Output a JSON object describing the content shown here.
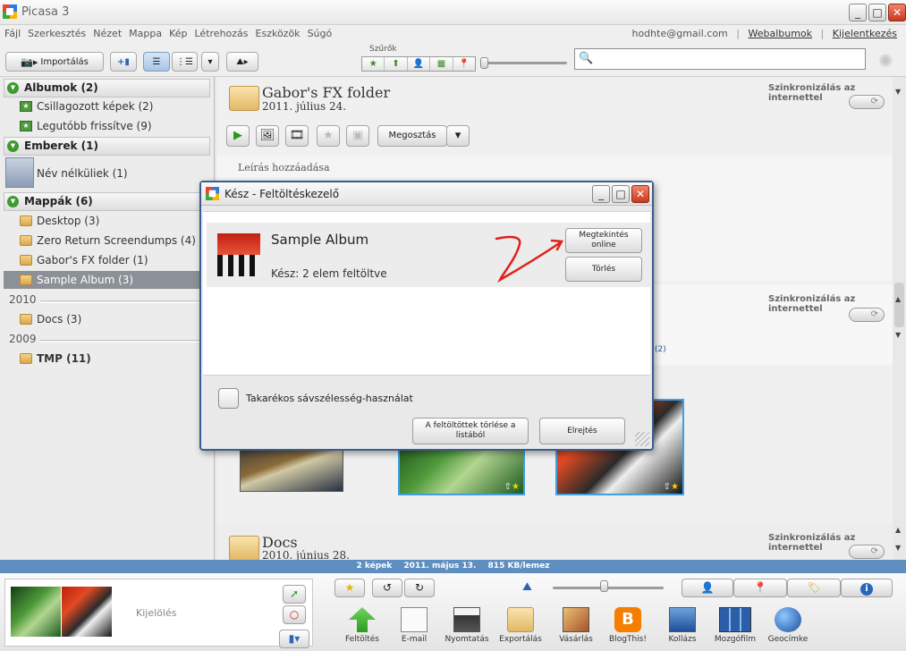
{
  "window": {
    "title": "Picasa 3",
    "min": "_",
    "max": "□",
    "close": "✕"
  },
  "menu": {
    "items": [
      "Fájl",
      "Szerkesztés",
      "Nézet",
      "Mappa",
      "Kép",
      "Létrehozás",
      "Eszközök",
      "Súgó"
    ],
    "account": "hodhte@gmail.com",
    "web_albums": "Webalbumok",
    "logout": "Kijelentkezés"
  },
  "toolbar": {
    "import": "Importálás",
    "filters_label": "Szűrők",
    "filter_icons": [
      "★",
      "⬆",
      "👤",
      "▦",
      "📍"
    ]
  },
  "sidebar": {
    "albums_header": "Albumok (2)",
    "albums": [
      "Csillagozott képek (2)",
      "Legutóbb frissítve (9)"
    ],
    "people_header": "Emberek (1)",
    "people": [
      "Név nélküliek (1)"
    ],
    "folders_header": "Mappák (6)",
    "folders": [
      "Desktop (3)",
      "Zero Return Screendumps (4)",
      "Gabor's FX folder (1)",
      "Sample Album (3)"
    ],
    "year1": "2010",
    "folders_2010": [
      "Docs (3)"
    ],
    "year2": "2009",
    "folders_2009": [
      "TMP (11)"
    ]
  },
  "main": {
    "album1_title": "Gabor's FX folder",
    "album1_date": "2011. július 24.",
    "sync_label": "Szinkronizálás az internettel",
    "share": "Megosztás",
    "description_placeholder": "Leírás hozzáadása",
    "album_count_link": "(2)",
    "album2_title": "Docs",
    "album2_date": "2010. június 28."
  },
  "status": {
    "count": "2 képek",
    "date": "2011. május 13.",
    "size": "815 KB/lemez"
  },
  "tray": {
    "selection_label": "Kijelölés",
    "actions": [
      "Feltöltés",
      "E-mail",
      "Nyomtatás",
      "Exportálás",
      "Vásárlás",
      "BlogThis!",
      "Kollázs",
      "Mozgófilm",
      "Geocímke"
    ]
  },
  "dialog": {
    "title": "Kész - Feltöltéskezelő",
    "album_name": "Sample Album",
    "status": "Kész: 2 elem feltöltve",
    "view_online": "Megtekintés online",
    "delete": "Törlés",
    "economy_label": "Takarékos sávszélesség-használat",
    "clear_uploaded": "A feltöltöttek törlése a listából",
    "hide": "Elrejtés"
  },
  "colors": {
    "status_bar": "#5e8fc0",
    "selected_item": "#8b9196",
    "dialog_border": "#3a5d8f",
    "arrow_annotation": "#e0201a"
  }
}
